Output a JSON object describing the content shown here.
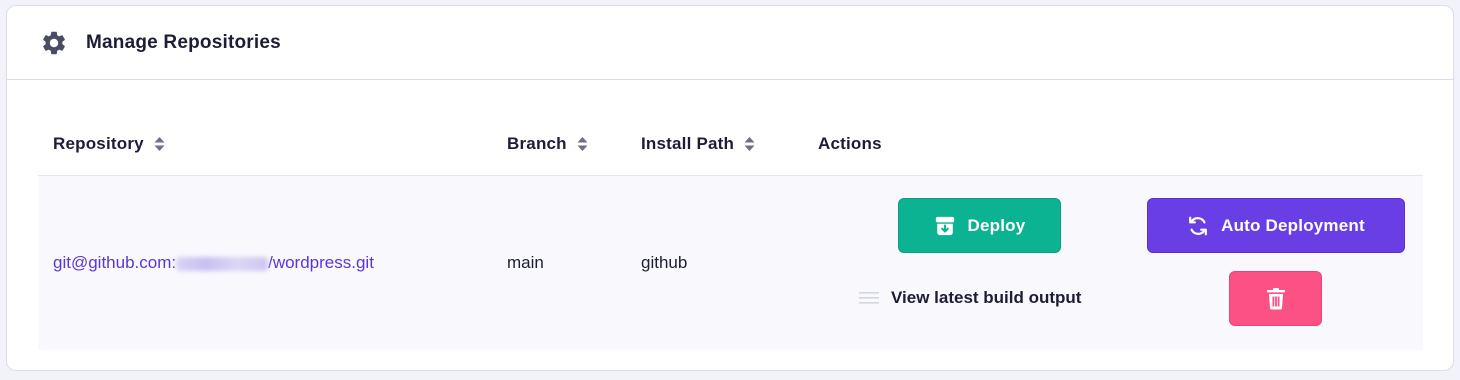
{
  "header": {
    "title": "Manage Repositories",
    "icon": "gear-icon"
  },
  "table": {
    "columns": [
      {
        "label": "Repository",
        "sortable": true
      },
      {
        "label": "Branch",
        "sortable": true
      },
      {
        "label": "Install Path",
        "sortable": true
      },
      {
        "label": "Actions",
        "sortable": false
      }
    ],
    "rows": [
      {
        "repo_prefix": "git@github.com:",
        "repo_suffix": "/wordpress.git",
        "branch": "main",
        "install_path": "github",
        "actions": {
          "deploy_label": "Deploy",
          "auto_deploy_label": "Auto Deployment",
          "build_output_label": "View latest build output",
          "delete_icon": "trash-icon"
        }
      }
    ]
  },
  "colors": {
    "accent": "#5c35d9",
    "deploy": "#0bb393",
    "auto_deploy": "#6a3ee5",
    "delete": "#fc5185"
  }
}
